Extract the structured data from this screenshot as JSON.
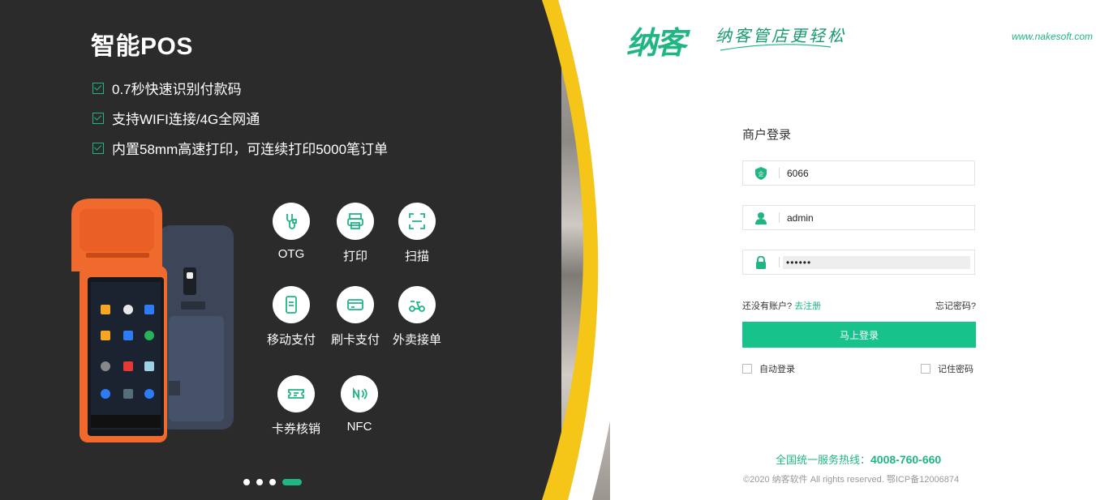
{
  "hero": {
    "title": "智能POS",
    "features": [
      "0.7秒快速识别付款码",
      "支持WIFI连接/4G全网通",
      "内置58mm高速打印，可连续打印5000笔订单"
    ],
    "functions": [
      {
        "label": "OTG",
        "icon": "usb-cable-icon"
      },
      {
        "label": "打印",
        "icon": "printer-icon"
      },
      {
        "label": "扫描",
        "icon": "scan-icon"
      },
      {
        "label": "移动支付",
        "icon": "mobile-pay-icon"
      },
      {
        "label": "刷卡支付",
        "icon": "card-pay-icon"
      },
      {
        "label": "外卖接单",
        "icon": "scooter-icon"
      },
      {
        "label": "卡券核销",
        "icon": "coupon-icon"
      },
      {
        "label": "NFC",
        "icon": "nfc-icon"
      }
    ],
    "carousel_active_index": 3,
    "carousel_count": 4
  },
  "brand": {
    "logo": "纳客",
    "slogan": "纳客管店更轻松",
    "website": "www.nakesoft.com"
  },
  "login": {
    "title": "商户登录",
    "merchant_value": "6066",
    "username_value": "admin",
    "password_mask": "••••••",
    "no_account": "还没有账户?",
    "register": "去注册",
    "forgot": "忘记密码?",
    "submit": "马上登录",
    "auto_login": "自动登录",
    "remember": "记住密码"
  },
  "footer": {
    "hotline_label": "全国统一服务热线：",
    "hotline_number": "4008-760-660",
    "copyright": "©2020 纳客软件 All rights reserved. 鄂ICP备12006874"
  },
  "colors": {
    "accent": "#17c28b",
    "dark_panel": "#2b2b2b",
    "curve": "#f5c518",
    "pos_orange": "#f06a2e"
  }
}
